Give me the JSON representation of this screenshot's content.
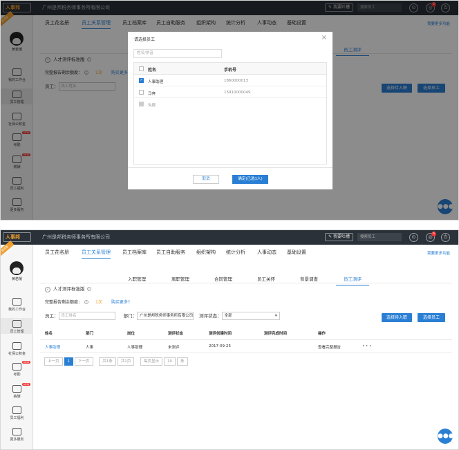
{
  "app": {
    "logo": "人事邦",
    "company": "广州是邦税务师事务所有限公司",
    "feedback": "我要吐槽",
    "search_placeholder": "搜索员工",
    "notif_count": "6"
  },
  "sidebar": {
    "ribbon": "测试版",
    "user": "黄若凝",
    "items": [
      {
        "label": "我的工作台",
        "icon": "monitor-icon"
      },
      {
        "label": "员工管理",
        "icon": "staff-icon"
      },
      {
        "label": "社保公积金",
        "icon": "house-icon"
      },
      {
        "label": "考勤",
        "icon": "calendar-icon",
        "new": "NEW"
      },
      {
        "label": "薪酬",
        "icon": "salary-icon",
        "new": "NEW"
      },
      {
        "label": "员工福利",
        "icon": "gift-icon"
      },
      {
        "label": "更多服务",
        "icon": "more-icon"
      }
    ]
  },
  "nav": {
    "items": [
      "员工花名册",
      "员工关系管理",
      "员工档案库",
      "员工自助服务",
      "组织架构",
      "统计分析",
      "人事动态",
      "基础设置"
    ],
    "active_index": 1,
    "more": "我要更多功能"
  },
  "subtabs": {
    "items": [
      "入职管理",
      "离职管理",
      "合同管理",
      "员工关怀",
      "背景调查",
      "员工测评"
    ],
    "active_index": 5
  },
  "page": {
    "back_title": "人才测评标准版",
    "credit_label": "完整报告剩余额度：",
    "credit_count": "1次",
    "buy_more": "购买更多?",
    "employee_label": "员工：",
    "employee_placeholder": "员工姓名",
    "dept_label": "部门：",
    "dept_value": "广州是邦税务师事务所有限公司",
    "status_label": "测评状态：",
    "status_value": "全部",
    "btn_select_onboard": "选择待入职",
    "btn_select_employee": "选择员工"
  },
  "table": {
    "headers": [
      "姓名",
      "部门",
      "岗位",
      "测评状态",
      "测评创建时间",
      "测评完成时间",
      "操作"
    ],
    "rows": [
      {
        "name": "人事助理",
        "dept": "人事",
        "position": "人事助理",
        "status": "未测评",
        "created": "2017-09-25",
        "finished": "",
        "action": "查看完整报告",
        "more": "• • •"
      }
    ]
  },
  "pager": {
    "prev": "上一页",
    "page": "1",
    "next": "下一页",
    "total_pages": "共1条",
    "total_items": "共1页",
    "per_page_label": "每页显示",
    "per_page": "10",
    "unit": "条"
  },
  "modal": {
    "title": "请选择员工",
    "search_placeholder": "姓名/拼音",
    "col_name": "姓名",
    "col_phone": "手机号",
    "rows": [
      {
        "name": "人事助理",
        "phone": "1860000013",
        "checked": true,
        "disabled": false
      },
      {
        "name": "马奔",
        "phone": "15910000049",
        "checked": false,
        "disabled": false
      },
      {
        "name": "沟廊",
        "phone": "",
        "checked": false,
        "disabled": true
      }
    ],
    "cancel": "取消",
    "confirm": "确定(已选1人)"
  },
  "colors": {
    "accent": "#2a7fd4",
    "topbar": "#2b3138",
    "orange": "#f0a030"
  }
}
